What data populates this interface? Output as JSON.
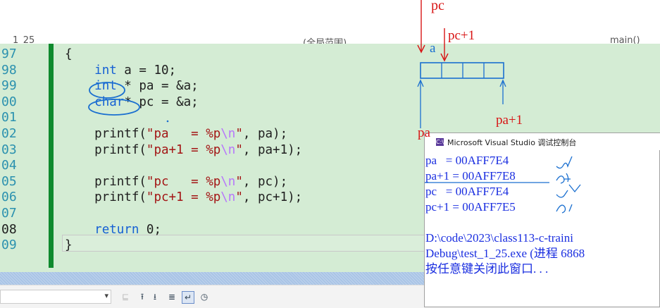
{
  "editor": {
    "top_fragment_left": "1_25",
    "top_fragment_mid": "(全局范围)",
    "top_fragment_right": "main()",
    "lines": [
      {
        "num": "97",
        "text": "{"
      },
      {
        "num": "98",
        "text": "    int a = 10;"
      },
      {
        "num": "99",
        "text": "    int * pa = &a;"
      },
      {
        "num": "00",
        "text": "    char* pc = &a;"
      },
      {
        "num": "01",
        "text": ""
      },
      {
        "num": "02",
        "text": "    printf(\"pa   = %p\\n\", pa);"
      },
      {
        "num": "03",
        "text": "    printf(\"pa+1 = %p\\n\", pa+1);"
      },
      {
        "num": "04",
        "text": ""
      },
      {
        "num": "05",
        "text": "    printf(\"pc   = %p\\n\", pc);"
      },
      {
        "num": "06",
        "text": "    printf(\"pc+1 = %p\\n\", pc+1);"
      },
      {
        "num": "07",
        "text": ""
      },
      {
        "num": "08",
        "text": "    return 0;"
      },
      {
        "num": "09",
        "text": "}"
      }
    ]
  },
  "console": {
    "icon_text": "C:\\",
    "title": "Microsoft Visual Studio 调试控制台",
    "lines": [
      "pa   = 00AFF7E4",
      "pa+1 = 00AFF7E8",
      "pc   = 00AFF7E4",
      "pc+1 = 00AFF7E5",
      "",
      "D:\\code\\2023\\class113-c-traini",
      "Debug\\test_1_25.exe (进程 6868",
      "按任意键关闭此窗口. . ."
    ]
  },
  "annotations": {
    "pc": "pc",
    "pc1": "pc+1",
    "a": "a",
    "pa1": "pa+1",
    "pa": "pa"
  },
  "colors": {
    "code_bg": "#d4ecd4",
    "keyword": "#1560d4",
    "string": "#a31515",
    "console_text": "#1a2ee0",
    "annotation_red": "#d81515",
    "annotation_blue": "#1a6fd0"
  }
}
